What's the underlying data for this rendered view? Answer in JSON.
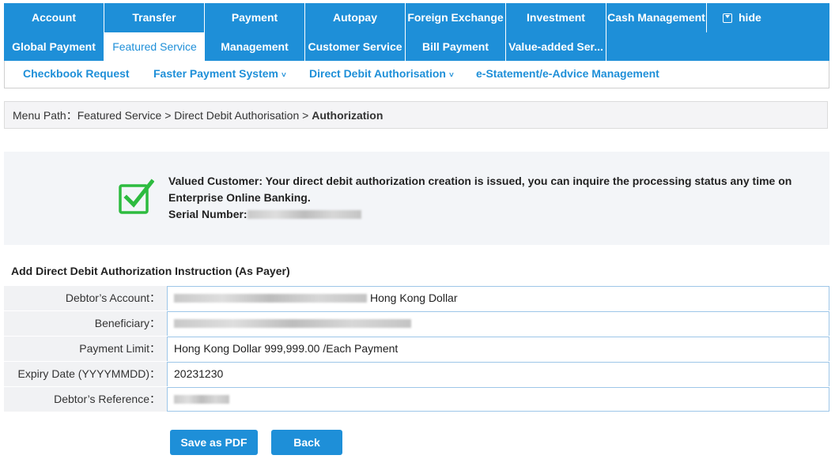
{
  "nav": {
    "row1": [
      "Account",
      "Transfer",
      "Payment",
      "Autopay",
      "Foreign Exchange",
      "Investment",
      "Cash Management"
    ],
    "hide_label": "hide",
    "row2": [
      "Global Payment",
      "Featured Service",
      "Management",
      "Customer Service",
      "Bill Payment",
      "Value-added Ser..."
    ]
  },
  "subnav": {
    "items": [
      "Checkbook Request",
      "Faster Payment System",
      "Direct Debit Authorisation",
      "e-Statement/e-Advice Management"
    ]
  },
  "menu_path": {
    "prefix": "Menu Path：Featured Service > Direct Debit Authorisation > ",
    "current": "Authorization"
  },
  "notice": {
    "message": "Valued Customer: Your direct debit authorization creation is issued, you can inquire the processing status any time on Enterprise Online Banking.",
    "serial_label": "Serial Number:"
  },
  "section_title": "Add Direct Debit Authorization Instruction (As Payer)",
  "form": {
    "debtor_account_label": "Debtor’s Account：",
    "debtor_account_currency": "Hong Kong Dollar",
    "beneficiary_label": "Beneficiary：",
    "payment_limit_label": "Payment Limit：",
    "payment_limit_value": "Hong Kong Dollar 999,999.00 /Each Payment",
    "expiry_label": "Expiry Date (YYYYMMDD)：",
    "expiry_value": "20231230",
    "reference_label": "Debtor’s Reference："
  },
  "buttons": {
    "save_pdf": "Save as PDF",
    "back": "Back"
  },
  "colors": {
    "primary": "#1e8fd8",
    "success_green": "#2dbb3f"
  }
}
